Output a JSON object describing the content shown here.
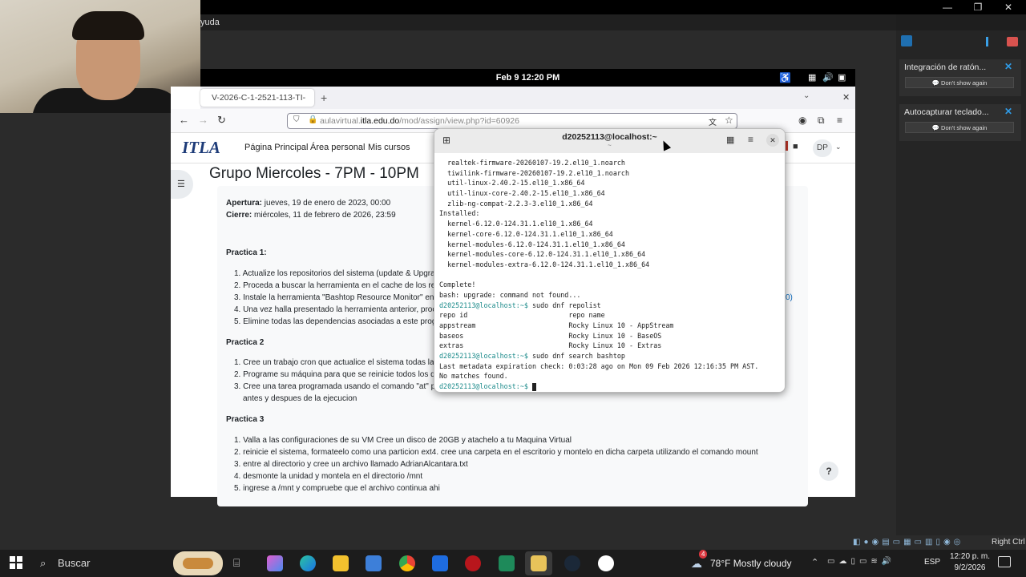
{
  "host": {
    "menu_partial": "yuda",
    "window_controls": [
      "—",
      "❐",
      "✕"
    ],
    "right_ctrl": "Right Ctrl"
  },
  "notifications": [
    {
      "title": "Integración de ratón...",
      "button": "💬 Don't show again"
    },
    {
      "title": "Autocapturar teclado...",
      "button": "💬 Don't show again"
    }
  ],
  "guest_topbar": {
    "clock": "Feb 9  12:20 PM"
  },
  "browser": {
    "tab_title": "V-2026-C-1-2521-113-TI-",
    "url_prefix": "aulavirtual.",
    "url_domain": "itla.edu.do",
    "url_suffix": "/mod/assign/view.php?id=60926"
  },
  "moodle": {
    "logo": "ITLA",
    "nav": [
      "Página Principal",
      "Área personal",
      "Mis cursos"
    ],
    "avatar": "DP",
    "title": "Grupo Miercoles - 7PM - 10PM",
    "opening_label": "Apertura:",
    "opening_value": " jueves, 19 de enero de 2023, 00:00",
    "closing_label": "Cierre:",
    "closing_value": " miércoles, 11 de febrero de 2026, 23:59",
    "practica1": {
      "heading": "Practica 1:",
      "items": [
        "1. Actualize los repositorios del sistema (update & Upgra",
        "2. Proceda a buscar la herramienta en el cache de los rep",
        "3. Instale la herramienta \"Bashtop Resource Monitor\" en",
        "4. Una vez halla presentado la herramienta anterior, proc",
        "5. Elimine todas las dependencias asociadas a este prog"
      ],
      "partial_right": "0)"
    },
    "practica2": {
      "heading": "Practica 2",
      "items": [
        "1. Cree un trabajo cron que actualice el sistema todas la",
        "2. Programe su máquina para que se reinicie todos los d",
        "3. Cree una tarea programada usando el comando \"at\" p"
      ],
      "continuation": "antes y despues de la ejecucion"
    },
    "practica3": {
      "heading": "Practica 3",
      "items": [
        "1. Valla a las configuraciones de su VM Cree un disco de 20GB y atachelo a tu Maquina Virtual",
        "2. reinicie el sistema, formateelo como una particion ext4. cree una carpeta en el escritorio y montelo en dicha carpeta utilizando el comando mount",
        "3. entre al directorio y cree un archivo llamado AdrianAlcantara.txt",
        "4. desmonte la unidad y montela en el directorio /mnt",
        "5. ingrese a /mnt y compruebe que el archivo continua ahi"
      ]
    },
    "help": "?"
  },
  "terminal": {
    "title": "d20252113@localhost:~",
    "subtitle": "~",
    "prompt": "d20252113@localhost:~$",
    "lines": [
      {
        "p": "",
        "t": "  realtek-firmware-20260107-19.2.el10_1.noarch"
      },
      {
        "p": "",
        "t": "  tiwilink-firmware-20260107-19.2.el10_1.noarch"
      },
      {
        "p": "",
        "t": "  util-linux-2.40.2-15.el10_1.x86_64"
      },
      {
        "p": "",
        "t": "  util-linux-core-2.40.2-15.el10_1.x86_64"
      },
      {
        "p": "",
        "t": "  zlib-ng-compat-2.2.3-3.el10_1.x86_64"
      },
      {
        "p": "",
        "t": "Installed:"
      },
      {
        "p": "",
        "t": "  kernel-6.12.0-124.31.1.el10_1.x86_64"
      },
      {
        "p": "",
        "t": "  kernel-core-6.12.0-124.31.1.el10_1.x86_64"
      },
      {
        "p": "",
        "t": "  kernel-modules-6.12.0-124.31.1.el10_1.x86_64"
      },
      {
        "p": "",
        "t": "  kernel-modules-core-6.12.0-124.31.1.el10_1.x86_64"
      },
      {
        "p": "",
        "t": "  kernel-modules-extra-6.12.0-124.31.1.el10_1.x86_64"
      },
      {
        "p": "",
        "t": ""
      },
      {
        "p": "",
        "t": "Complete!"
      },
      {
        "p": "",
        "t": "bash: upgrade: command not found..."
      },
      {
        "p": "d20252113@localhost:~$",
        "t": " sudo dnf repolist"
      },
      {
        "p": "",
        "t": "repo id                         repo name"
      },
      {
        "p": "",
        "t": "appstream                       Rocky Linux 10 - AppStream"
      },
      {
        "p": "",
        "t": "baseos                          Rocky Linux 10 - BaseOS"
      },
      {
        "p": "",
        "t": "extras                          Rocky Linux 10 - Extras"
      },
      {
        "p": "d20252113@localhost:~$",
        "t": " sudo dnf search bashtop"
      },
      {
        "p": "",
        "t": "Last metadata expiration check: 0:03:28 ago on Mon 09 Feb 2026 12:16:35 PM AST."
      },
      {
        "p": "",
        "t": "No matches found."
      },
      {
        "p": "d20252113@localhost:~$",
        "t": " "
      }
    ]
  },
  "taskbar": {
    "search": "Buscar",
    "weather": "78°F  Mostly cloudy",
    "weather_badge": "4",
    "lang": "ESP",
    "time": "12:20 p. m.",
    "date": "9/2/2026"
  }
}
